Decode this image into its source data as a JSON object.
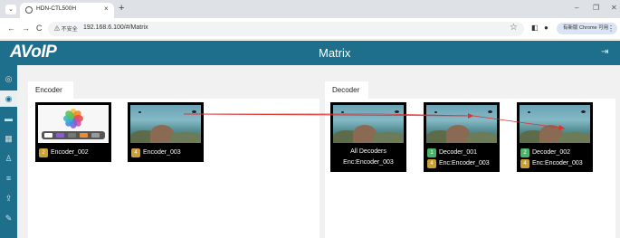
{
  "browser": {
    "tab_title": "HDN-CTL500H",
    "tab_close": "×",
    "new_tab": "+",
    "back": "←",
    "forward": "→",
    "reload": "C",
    "insecure_label": "⚠ 不安全",
    "url": "192.168.6.100/#/Matrix",
    "update_label": "有新版 Chrome 可用",
    "menu": "⋮"
  },
  "app": {
    "logo": "AVoIP",
    "page_title": "Matrix"
  },
  "sidebar": {
    "items": [
      {
        "icon": "layers-icon",
        "glyph": "◎"
      },
      {
        "icon": "target-icon",
        "glyph": "◉"
      },
      {
        "icon": "stack-icon",
        "glyph": "▬"
      },
      {
        "icon": "grid-icon",
        "glyph": "▦"
      },
      {
        "icon": "user-icon",
        "glyph": "♙"
      },
      {
        "icon": "sliders-icon",
        "glyph": "≡"
      },
      {
        "icon": "upload-icon",
        "glyph": "⇪"
      },
      {
        "icon": "wrench-icon",
        "glyph": "✎"
      }
    ],
    "active_index": 1
  },
  "encoder_panel": {
    "tab_label": "Encoder",
    "tiles": [
      {
        "badge": "2",
        "label": "Encoder_002",
        "preview": "photos-app"
      },
      {
        "badge": "4",
        "label": "Encoder_003",
        "preview": "aquarium"
      }
    ]
  },
  "decoder_panel": {
    "tab_label": "Decoder",
    "tiles": [
      {
        "line1": "All Decoders",
        "line2": "Enc:Encoder_003"
      },
      {
        "badge1": "1",
        "line1": "Decoder_001",
        "badge2": "4",
        "line2": "Enc:Encoder_003"
      },
      {
        "badge1": "2",
        "line1": "Decoder_002",
        "badge2": "4",
        "line2": "Enc:Encoder_003"
      }
    ]
  },
  "colors": {
    "header": "#1e6f8c",
    "route_line": "#e03030",
    "badge_yellow": "#c9a033",
    "badge_green": "#4db36a"
  }
}
